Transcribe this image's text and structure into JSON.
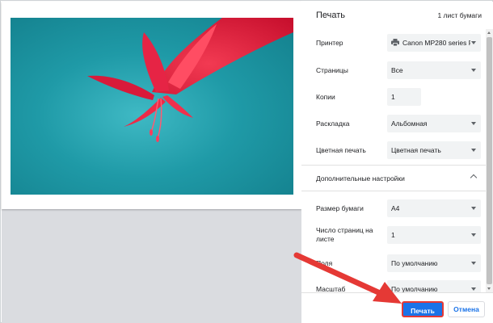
{
  "header": {
    "title": "Печать",
    "sheet_count": "1 лист бумаги"
  },
  "settings": {
    "printer": {
      "label": "Принтер",
      "value": "Canon MP280 series P"
    },
    "pages": {
      "label": "Страницы",
      "value": "Все"
    },
    "copies": {
      "label": "Копии",
      "value": "1"
    },
    "layout": {
      "label": "Раскладка",
      "value": "Альбомная"
    },
    "color": {
      "label": "Цветная печать",
      "value": "Цветная печать"
    }
  },
  "advanced": {
    "label": "Дополнительные настройки",
    "paper_size": {
      "label": "Размер бумаги",
      "value": "A4"
    },
    "pages_per_sheet": {
      "label": "Число страниц на листе",
      "value": "1"
    },
    "margins": {
      "label": "Поля",
      "value": "По умолчанию"
    },
    "scale": {
      "label": "Масштаб",
      "value": "По умолчанию"
    }
  },
  "footer": {
    "print_label": "Печать",
    "cancel_label": "Отмена"
  },
  "colors": {
    "accent": "#1a73e8",
    "annotation_arrow": "#e53935",
    "photo_bg": "#1f9aa7",
    "flower": "#e8213f"
  },
  "icons": {
    "printer": "printer-icon",
    "dropdown": "chevron-down-icon",
    "collapse": "chevron-up-icon"
  }
}
